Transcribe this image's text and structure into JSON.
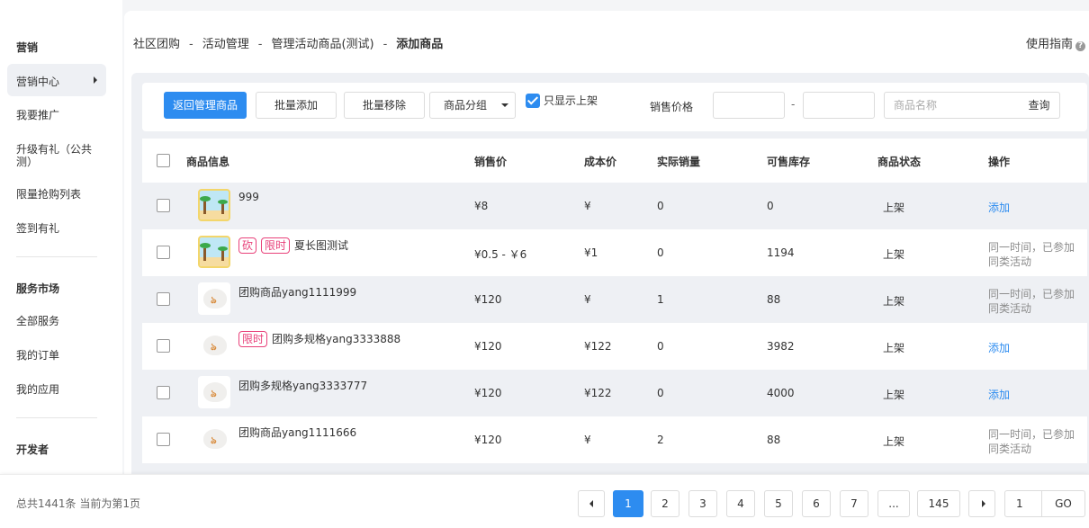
{
  "sidebar": {
    "sections": [
      {
        "title": "营销",
        "items": [
          "营销中心",
          "我要推广",
          "升级有礼（公共测）",
          "限量抢购列表",
          "签到有礼"
        ]
      },
      {
        "title": "服务市场",
        "items": [
          "全部服务",
          "我的订单",
          "我的应用"
        ]
      },
      {
        "title": "开发者",
        "items": []
      }
    ],
    "active_item": "营销中心"
  },
  "breadcrumb": [
    "社区团购",
    "活动管理",
    "管理活动商品(测试)",
    "添加商品"
  ],
  "breadcrumb_sep": "-",
  "guide_label": "使用指南",
  "guide_icon": "help-circle-icon",
  "toolbar": {
    "back_label": "返回管理商品",
    "batch_add_label": "批量添加",
    "batch_remove_label": "批量移除",
    "group_select_label": "商品分组",
    "only_on_shelf_label": "只显示上架",
    "only_on_shelf_checked": true,
    "price_label": "销售价格",
    "price_dash": "-",
    "name_placeholder": "商品名称",
    "query_label": "查询"
  },
  "table": {
    "headers": [
      "商品信息",
      "销售价",
      "成本价",
      "实际销量",
      "可售库存",
      "商品状态",
      "操作"
    ],
    "rows": [
      {
        "thumb": "beach",
        "tags": [],
        "name": "999",
        "price": "¥8",
        "cost": "¥",
        "sales": "0",
        "stock": "0",
        "status": "上架",
        "action": "添加",
        "action_type": "link"
      },
      {
        "thumb": "beach",
        "tags": [
          "砍",
          "限时"
        ],
        "name": "夏长图测试",
        "price": "¥0.5 - ￥6",
        "cost": "¥1",
        "sales": "0",
        "stock": "1194",
        "status": "上架",
        "action": "同一时间，已参加同类活动",
        "action_type": "muted"
      },
      {
        "thumb": "bubble",
        "tags": [],
        "name": "团购商品yang1111999",
        "price": "¥120",
        "cost": "¥",
        "sales": "1",
        "stock": "88",
        "status": "上架",
        "action": "同一时间，已参加同类活动",
        "action_type": "muted"
      },
      {
        "thumb": "bubble",
        "tags": [
          "限时"
        ],
        "name": "团购多规格yang3333888",
        "price": "¥120",
        "cost": "¥122",
        "sales": "0",
        "stock": "3982",
        "status": "上架",
        "action": "添加",
        "action_type": "link"
      },
      {
        "thumb": "bubble",
        "tags": [],
        "name": "团购多规格yang3333777",
        "price": "¥120",
        "cost": "¥122",
        "sales": "0",
        "stock": "4000",
        "status": "上架",
        "action": "添加",
        "action_type": "link"
      },
      {
        "thumb": "bubble",
        "tags": [],
        "name": "团购商品yang1111666",
        "price": "¥120",
        "cost": "¥",
        "sales": "2",
        "stock": "88",
        "status": "上架",
        "action": "同一时间，已参加同类活动",
        "action_type": "muted"
      }
    ]
  },
  "pagination": {
    "total_text": "总共1441条 当前为第1页",
    "pages": [
      "1",
      "2",
      "3",
      "4",
      "5",
      "6",
      "7",
      "...",
      "145"
    ],
    "current": "1",
    "goto_value": "1",
    "go_label": "GO"
  },
  "colors": {
    "primary": "#2d8cf0",
    "tag": "#e8417a",
    "row_alt": "#eef0f4"
  }
}
